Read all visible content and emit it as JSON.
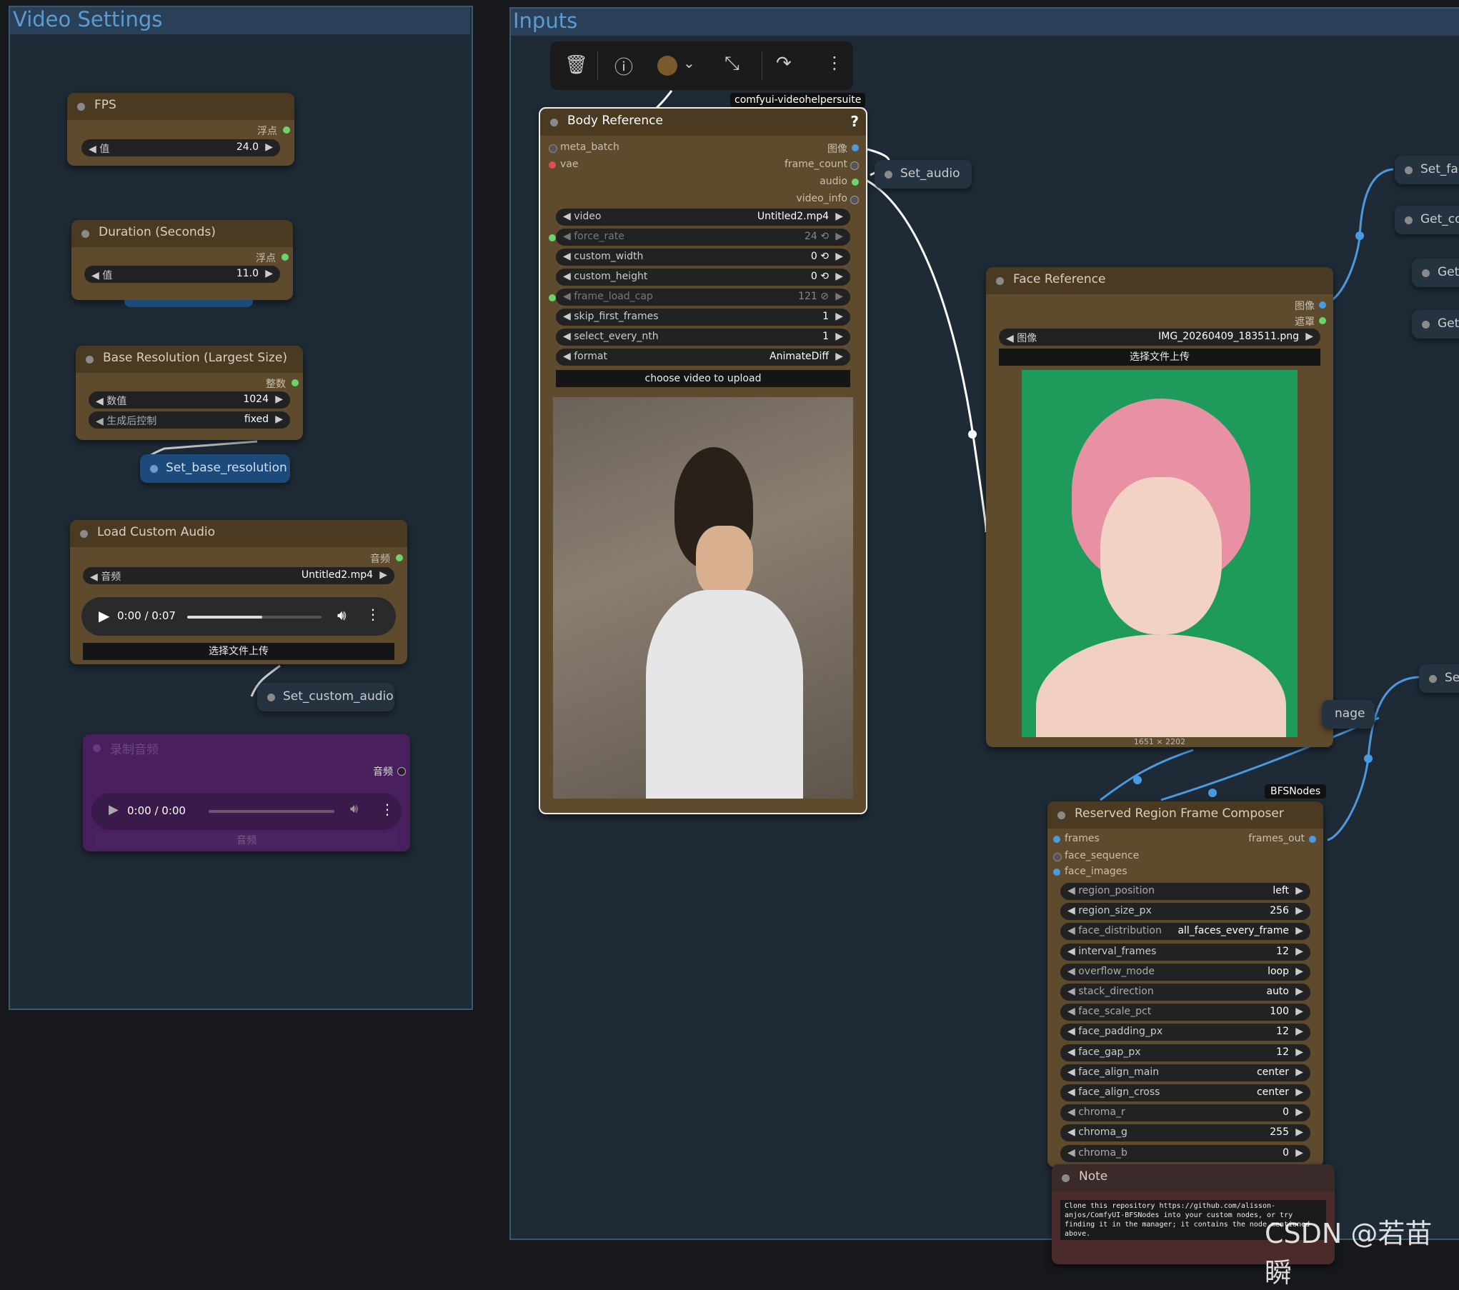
{
  "groups": {
    "video_settings": "Video Settings",
    "inputs": "Inputs"
  },
  "fps": {
    "title": "FPS",
    "out": "浮点",
    "label": "值",
    "value": "24.0"
  },
  "duration": {
    "title": "Duration (Seconds)",
    "out": "浮点",
    "label": "值",
    "value": "11.0"
  },
  "base_res": {
    "title": "Base Resolution (Largest Size)",
    "out": "整数",
    "w1_label": "数值",
    "w1_value": "1024",
    "w2_label": "生成后控制",
    "w2_value": "fixed"
  },
  "set_base_resolution": "Set_base_resolution",
  "load_audio": {
    "title": "Load Custom Audio",
    "out": "音频",
    "label": "音频",
    "value": "Untitled2.mp4",
    "time": "0:00 / 0:07",
    "upload": "选择文件上传"
  },
  "set_custom_audio": "Set_custom_audio",
  "record_audio": {
    "title": "录制音频",
    "out": "音频",
    "time": "0:00 / 0:00",
    "footer": "音频"
  },
  "toolbar_badge": "comfyui-videohelpersuite",
  "body_ref": {
    "title": "Body Reference",
    "help": "?",
    "inputs": [
      "meta_batch",
      "vae"
    ],
    "outputs": [
      "图像",
      "frame_count",
      "audio",
      "video_info"
    ],
    "widgets": [
      {
        "label": "video",
        "value": "Untitled2.mp4"
      },
      {
        "label": "force_rate",
        "value": "24 ⟲"
      },
      {
        "label": "custom_width",
        "value": "0 ⟲"
      },
      {
        "label": "custom_height",
        "value": "0 ⟲"
      },
      {
        "label": "frame_load_cap",
        "value": "121 ⊘"
      },
      {
        "label": "skip_first_frames",
        "value": "1"
      },
      {
        "label": "select_every_nth",
        "value": "1"
      },
      {
        "label": "format",
        "value": "AnimateDiff"
      }
    ],
    "upload": "choose video to upload"
  },
  "set_audio": "Set_audio",
  "face_ref": {
    "title": "Face Reference",
    "outputs": [
      "图像",
      "遮罩"
    ],
    "label": "图像",
    "value": "IMG_20260409_183511.png",
    "upload": "选择文件上传",
    "dims": "1651 × 2202"
  },
  "right_nodes": [
    "Set_fac",
    "Get_co",
    "Get_",
    "Get_",
    "Se"
  ],
  "image_stub": "nage",
  "bfs_badge": "BFSNodes",
  "composer": {
    "title": "Reserved Region Frame Composer",
    "inputs": [
      "frames",
      "face_sequence",
      "face_images"
    ],
    "output": "frames_out",
    "widgets": [
      {
        "label": "region_position",
        "value": "left"
      },
      {
        "label": "region_size_px",
        "value": "256"
      },
      {
        "label": "face_distribution",
        "value": "all_faces_every_frame"
      },
      {
        "label": "interval_frames",
        "value": "12"
      },
      {
        "label": "overflow_mode",
        "value": "loop"
      },
      {
        "label": "stack_direction",
        "value": "auto"
      },
      {
        "label": "face_scale_pct",
        "value": "100"
      },
      {
        "label": "face_padding_px",
        "value": "12"
      },
      {
        "label": "face_gap_px",
        "value": "12"
      },
      {
        "label": "face_align_main",
        "value": "center"
      },
      {
        "label": "face_align_cross",
        "value": "center"
      },
      {
        "label": "chroma_r",
        "value": "0"
      },
      {
        "label": "chroma_g",
        "value": "255"
      },
      {
        "label": "chroma_b",
        "value": "0"
      }
    ]
  },
  "note": {
    "title": "Note",
    "text": "Clone this repository https://github.com/alisson-anjos/ComfyUI-BFSNodes into your custom nodes, or try finding it in the manager; it contains the node mentioned above."
  },
  "watermark": "CSDN @若苗瞬"
}
